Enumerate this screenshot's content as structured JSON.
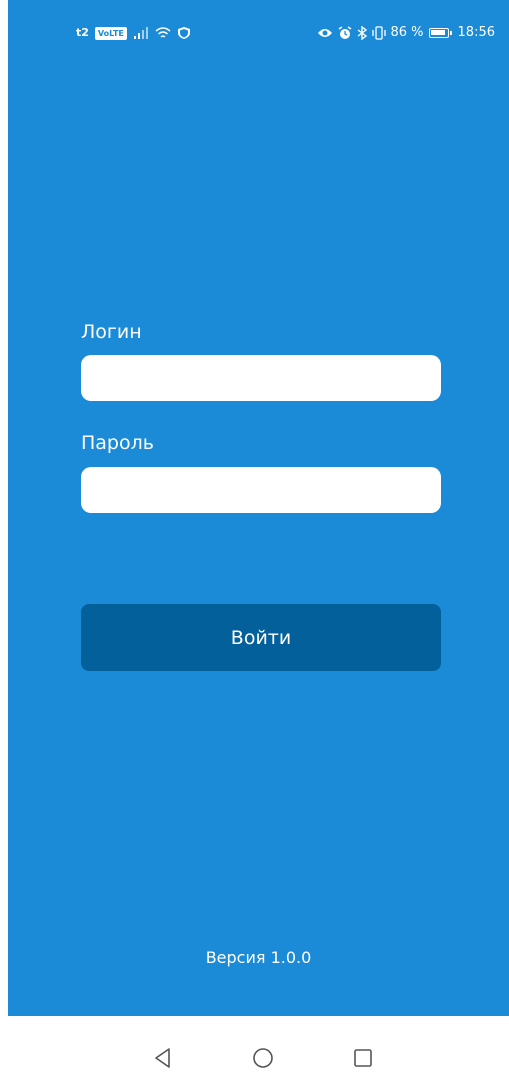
{
  "status_bar": {
    "carrier": "t2",
    "network_badge": "VoLTE",
    "battery_percent": "86 %",
    "time": "18:56",
    "icons": [
      "signal-icon",
      "wifi-icon",
      "shield-icon",
      "eye-icon",
      "alarm-icon",
      "bluetooth-icon",
      "vibrate-icon",
      "battery-icon"
    ]
  },
  "form": {
    "login_label": "Логин",
    "login_value": "",
    "password_label": "Пароль",
    "password_value": "",
    "submit_label": "Войти"
  },
  "footer": {
    "version": "Версия 1.0.0"
  },
  "nav_bar": {
    "buttons": [
      "back-icon",
      "home-icon",
      "recents-icon"
    ]
  },
  "colors": {
    "background": "#1b8bd8",
    "button": "#03609b",
    "text": "#ffffff"
  }
}
